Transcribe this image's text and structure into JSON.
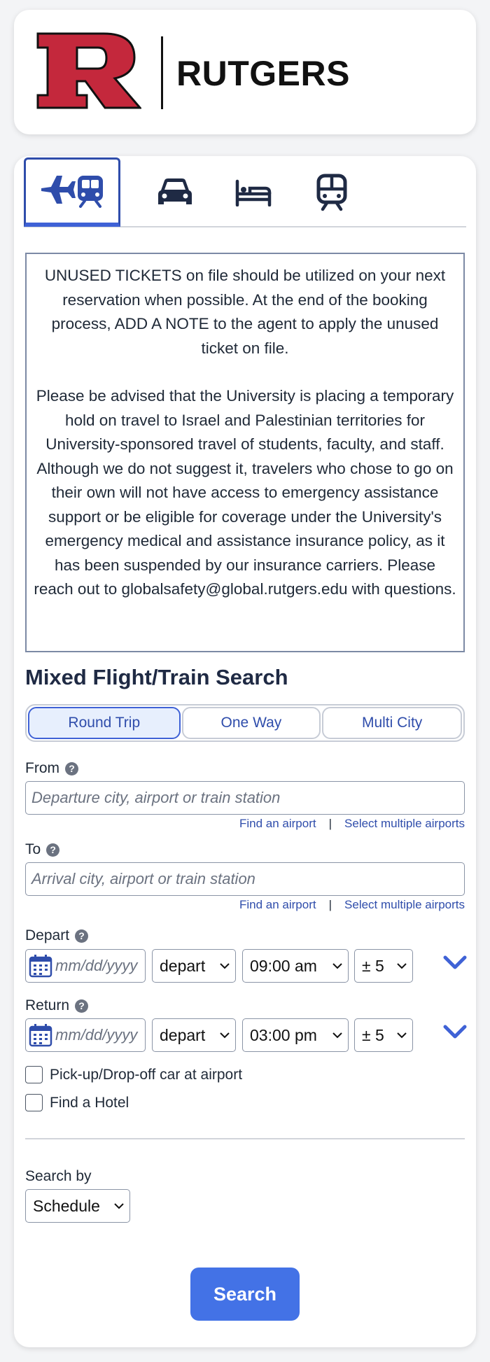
{
  "brand": {
    "name": "RUTGERS",
    "color": "#cc0033"
  },
  "tabs": [
    {
      "name": "flight-train",
      "icon": "plane-train-icon",
      "active": true
    },
    {
      "name": "car",
      "icon": "car-icon",
      "active": false
    },
    {
      "name": "hotel",
      "icon": "bed-icon",
      "active": false
    },
    {
      "name": "train",
      "icon": "train-icon",
      "active": false
    }
  ],
  "notice": {
    "paragraph1": "UNUSED TICKETS on file should be utilized on your next reservation when possible. At the end of the booking process, ADD A NOTE to the agent to apply the unused ticket on file.",
    "paragraph2": "Please be advised that the University is placing a temporary hold on travel to Israel and Palestinian territories for University-sponsored travel of students, faculty, and staff. Although we do not suggest it, travelers who chose to go on their own will not have access to emergency assistance support or be eligible for coverage under the University's emergency medical and assistance insurance policy, as it has been suspended by our insurance carriers. Please reach out to globalsafety@global.rutgers.edu with questions."
  },
  "search": {
    "title": "Mixed Flight/Train Search",
    "trip_types": [
      "Round Trip",
      "One Way",
      "Multi City"
    ],
    "selected_trip_type": "Round Trip",
    "from": {
      "label": "From",
      "placeholder": "Departure city, airport or train station",
      "value": ""
    },
    "to": {
      "label": "To",
      "placeholder": "Arrival city, airport or train station",
      "value": ""
    },
    "links": {
      "find_airport": "Find an airport",
      "separator": "|",
      "multiple": "Select multiple airports"
    },
    "depart": {
      "label": "Depart",
      "date_placeholder": "mm/dd/yyyy",
      "type": "depart",
      "time": "09:00 am",
      "range": "± 5"
    },
    "return": {
      "label": "Return",
      "date_placeholder": "mm/dd/yyyy",
      "type": "depart",
      "time": "03:00 pm",
      "range": "± 5"
    },
    "options": {
      "car": "Pick-up/Drop-off car at airport",
      "hotel": "Find a Hotel"
    },
    "search_by": {
      "label": "Search by",
      "value": "Schedule"
    },
    "button": "Search"
  },
  "colors": {
    "accent": "#4372e6",
    "link": "#2f4dab",
    "active_tab_border": "#2f4dab"
  }
}
